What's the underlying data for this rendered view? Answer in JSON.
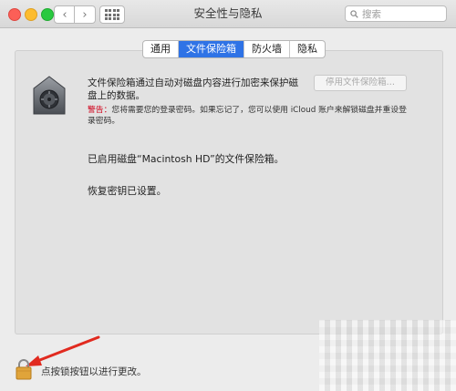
{
  "window": {
    "title": "安全性与隐私",
    "search_placeholder": "搜索"
  },
  "toolbar": {
    "back": "‹",
    "forward": "›"
  },
  "tabs": [
    {
      "label": "通用",
      "active": false
    },
    {
      "label": "文件保险箱",
      "active": true
    },
    {
      "label": "防火墙",
      "active": false
    },
    {
      "label": "隐私",
      "active": false
    }
  ],
  "filevault": {
    "description": "文件保险箱通过自动对磁盘内容进行加密来保护磁盘上的数据。",
    "enable_button": "停用文件保险箱…",
    "warning_label": "警告：",
    "warning_text": "您将需要您的登录密码。如果忘记了，您可以使用 iCloud 账户来解锁磁盘并重设登录密码。",
    "status_enabled": "已启用磁盘“Macintosh HD”的文件保险箱。",
    "status_recovery": "恢复密钥已设置。"
  },
  "footer": {
    "lock_text": "点按锁按钮以进行更改。"
  },
  "colors": {
    "accent": "#2f73e6",
    "warning": "#d0021b",
    "arrow": "#e12a1f"
  }
}
